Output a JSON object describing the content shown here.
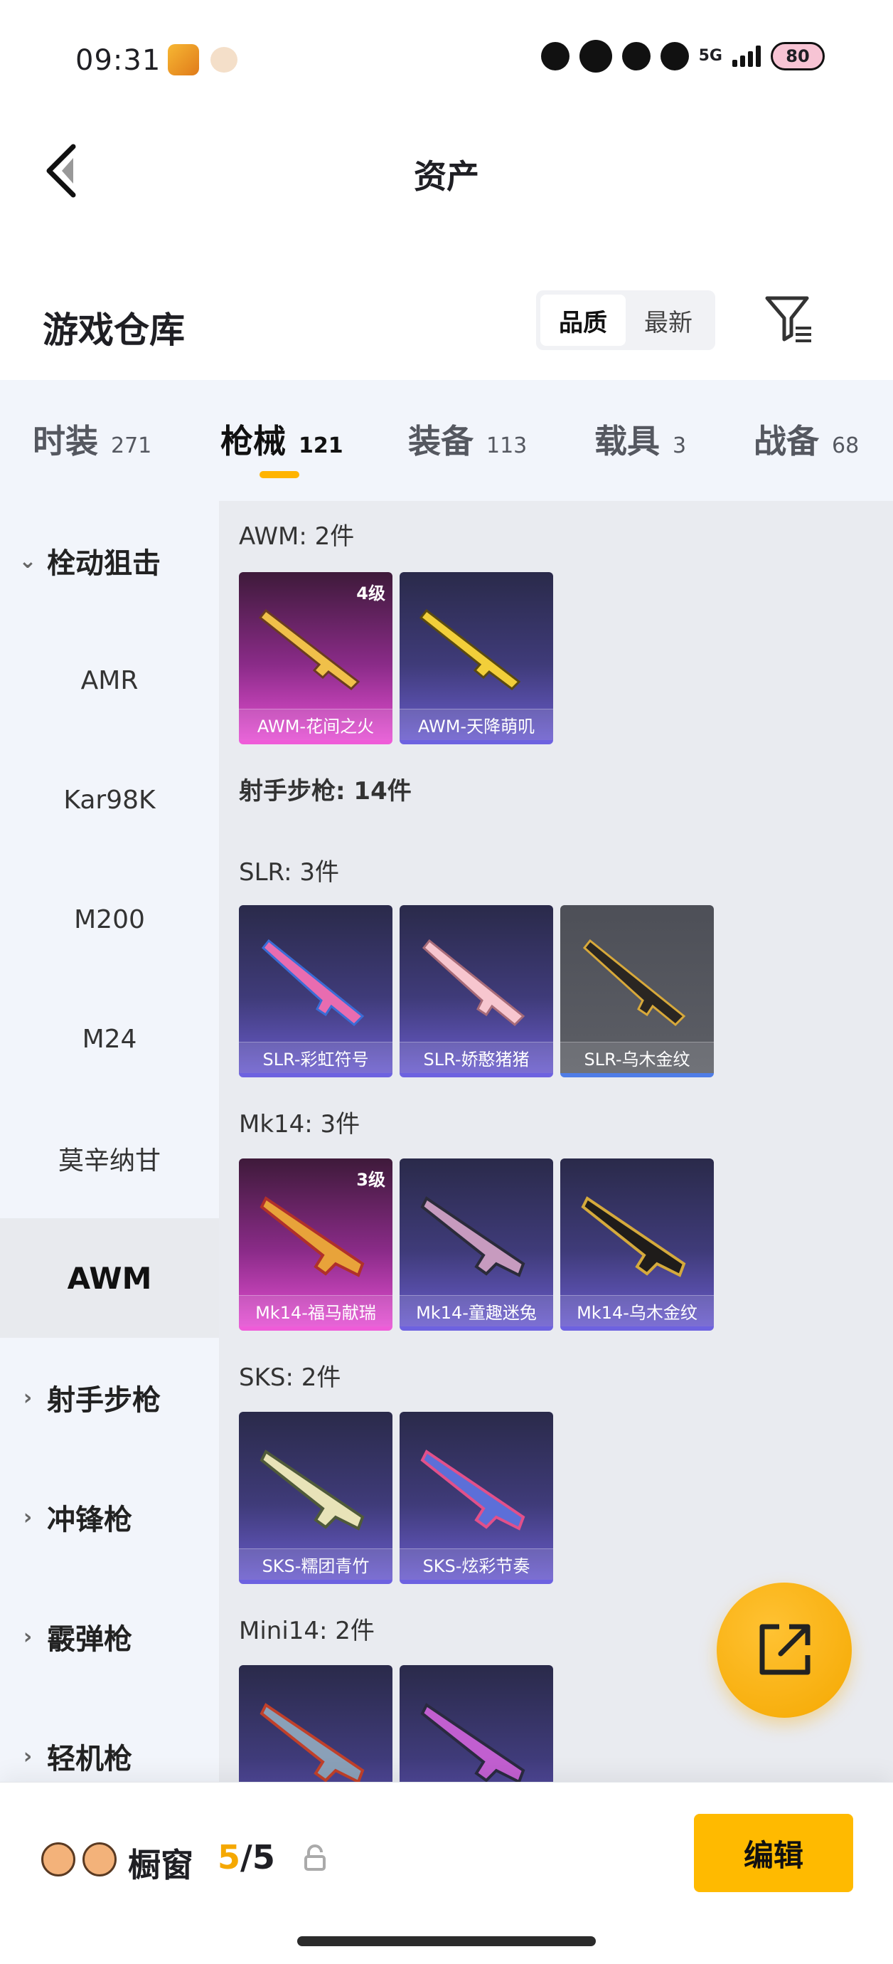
{
  "status_bar": {
    "time": "09:31",
    "network": "5G",
    "battery": "80"
  },
  "header": {
    "title": "资产"
  },
  "toolbar": {
    "warehouse_title": "游戏仓库",
    "sort_quality": "品质",
    "sort_latest": "最新"
  },
  "categories": [
    {
      "label": "时装",
      "count": "271"
    },
    {
      "label": "枪械",
      "count": "121"
    },
    {
      "label": "装备",
      "count": "113"
    },
    {
      "label": "载具",
      "count": "3"
    },
    {
      "label": "战备",
      "count": "68"
    }
  ],
  "sidebar": {
    "group_bolt": "栓动狙击",
    "items": [
      "AMR",
      "Kar98K",
      "M200",
      "M24",
      "莫辛纳甘",
      "AWM"
    ],
    "group_dmr": "射手步枪",
    "group_smg": "冲锋枪",
    "group_shotgun": "霰弹枪",
    "group_lmg": "轻机枪"
  },
  "content": {
    "awm_title": "AWM: 2件",
    "awm_cards": [
      {
        "name": "AWM-花间之火",
        "level": "4级"
      },
      {
        "name": "AWM-天降萌叽"
      }
    ],
    "dmr_title": "射手步枪: 14件",
    "slr_title": "SLR: 3件",
    "slr_cards": [
      {
        "name": "SLR-彩虹符号"
      },
      {
        "name": "SLR-娇憨猪猪"
      },
      {
        "name": "SLR-乌木金纹"
      }
    ],
    "mk14_title": "Mk14: 3件",
    "mk14_cards": [
      {
        "name": "Mk14-福马献瑞",
        "level": "3级"
      },
      {
        "name": "Mk14-童趣迷兔"
      },
      {
        "name": "Mk14-乌木金纹"
      }
    ],
    "sks_title": "SKS: 2件",
    "sks_cards": [
      {
        "name": "SKS-糯团青竹"
      },
      {
        "name": "SKS-炫彩节奏"
      }
    ],
    "mini14_title": "Mini14: 2件"
  },
  "bottom_bar": {
    "shelf_label": "橱窗",
    "shelf_used": "5",
    "shelf_sep": "/",
    "shelf_total": "5",
    "edit_label": "编辑"
  },
  "colors": {
    "accent": "#ffba00",
    "rarity_pink": "#ef5bd8",
    "rarity_purple": "#6d62e0",
    "rarity_blue": "#4f7de6"
  }
}
